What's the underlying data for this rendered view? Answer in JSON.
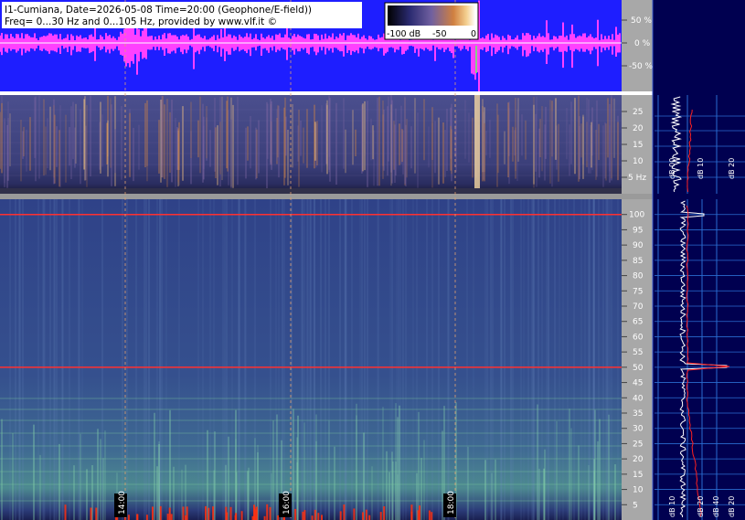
{
  "header": {
    "line1": "I1-Cumiana, Date=2026-05-08 Time=20:00 (Geophone/E-field))",
    "line2": "Freq= 0...30 Hz and 0...105 Hz, provided by www.vlf.it ©"
  },
  "colorbar": {
    "labels": [
      "-100 dB",
      "-50",
      "0"
    ],
    "gradient": [
      "#000000",
      "#3a3a8c",
      "#6e5aa0",
      "#c8783c",
      "#f0c070",
      "#ffffff"
    ]
  },
  "chart_data": [
    {
      "type": "line",
      "panel": "waveform",
      "ytick_labels": [
        "50 %",
        "0 %",
        "-50 %"
      ],
      "ylim": [
        -100,
        100
      ],
      "colors": {
        "background": "#1e1eff",
        "trace": "#ff40ff",
        "axis": "#a8a8a8",
        "grid": "#808080"
      }
    },
    {
      "type": "heatmap",
      "panel": "spectrogram-low",
      "ylim": [
        0,
        30
      ],
      "ytick_values": [
        5,
        10,
        15,
        20,
        25
      ],
      "ytick_labels": [
        "5 Hz",
        "10",
        "15",
        "20",
        "25"
      ],
      "colors": {
        "background": "#3a3e80",
        "hot": "#e8a050",
        "axis": "#a8a8a8"
      }
    },
    {
      "type": "heatmap",
      "panel": "spectrogram-high",
      "ylim": [
        0,
        105
      ],
      "ytick_values": [
        5,
        10,
        15,
        20,
        25,
        30,
        35,
        40,
        45,
        50,
        55,
        60,
        65,
        70,
        75,
        80,
        85,
        90,
        95,
        100
      ],
      "ytick_labels": [
        "5",
        "10",
        "15",
        "20",
        "25",
        "30",
        "35",
        "40",
        "45",
        "50",
        "55",
        "60",
        "65",
        "70",
        "75",
        "80",
        "85",
        "90",
        "95",
        "100"
      ],
      "line_frequencies_hz": [
        50,
        100
      ],
      "time_markers": [
        "14:00",
        "16:00",
        "18:00"
      ],
      "colors": {
        "background": "#34488c",
        "line": "#ff3030",
        "green": "#70d090",
        "axis": "#a8a8a8"
      }
    },
    {
      "type": "line",
      "panel": "spectrum-low",
      "series": [
        {
          "color": "#ffffff"
        },
        {
          "color": "#ff2020"
        }
      ],
      "xtick_labels": [
        "dB 00",
        "dB 10",
        "dB 20"
      ],
      "colors": {
        "background": "#000050",
        "grid": "#2a6cd0"
      }
    },
    {
      "type": "line",
      "panel": "spectrum-high",
      "series": [
        {
          "color": "#ffffff"
        },
        {
          "color": "#ff2020"
        }
      ],
      "xtick_labels": [
        "dB 10",
        "dB 20",
        "dB 40",
        "dB 20"
      ],
      "colors": {
        "background": "#000050",
        "grid": "#2a6cd0"
      }
    }
  ]
}
